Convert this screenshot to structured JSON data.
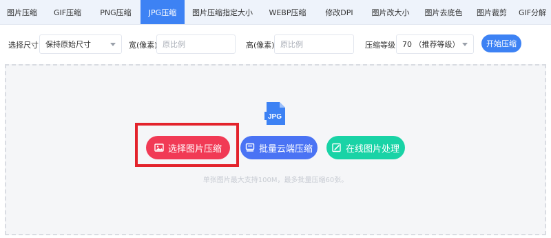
{
  "tabs": [
    {
      "label": "图片压缩",
      "active": false
    },
    {
      "label": "GIF压缩",
      "active": false
    },
    {
      "label": "PNG压缩",
      "active": false
    },
    {
      "label": "JPG压缩",
      "active": true
    },
    {
      "label": "图片压缩指定大小",
      "active": false
    },
    {
      "label": "WEBP压缩",
      "active": false
    },
    {
      "label": "修改DPI",
      "active": false
    },
    {
      "label": "图片改大小",
      "active": false
    },
    {
      "label": "图片去底色",
      "active": false
    },
    {
      "label": "图片裁剪",
      "active": false
    },
    {
      "label": "GIF分解",
      "active": false
    }
  ],
  "settings": {
    "size_label": "选择尺寸",
    "size_value": "保持原始尺寸",
    "width_label": "宽(像素)",
    "width_placeholder": "原比例",
    "height_label": "高(像素)",
    "height_placeholder": "原比例",
    "level_label": "压缩等级",
    "level_value": "70  （推荐等级）",
    "start_label": "开始压缩"
  },
  "dropzone": {
    "file_type_badge": "JPG",
    "select_label": "选择图片压缩",
    "batch_label": "批量云端压缩",
    "online_label": "在线图片处理",
    "note": "单张图片最大支持100M，最多批量压缩60张。"
  },
  "colors": {
    "accent": "#3d82f4",
    "select_button": "#f13a55",
    "batch_button": "#4a73f4",
    "online_button": "#19d3a6",
    "highlight_box": "#e3232c"
  },
  "icons": {
    "select": "image-icon",
    "batch": "cloud-server-icon",
    "online": "edit-image-icon",
    "file": "jpg-file-icon"
  }
}
